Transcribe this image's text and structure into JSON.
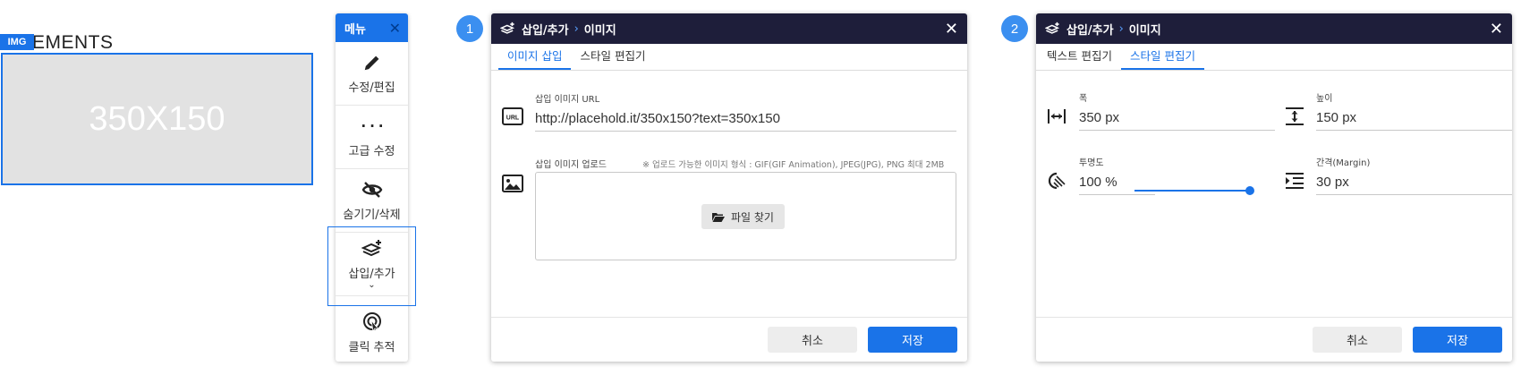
{
  "preview": {
    "heading": "EMENTS",
    "badge": "IMG",
    "placeholder_text": "350X150"
  },
  "menu": {
    "title": "메뉴",
    "close": "✕",
    "items": [
      {
        "label": "수정/편집",
        "icon": "pencil-icon"
      },
      {
        "label": "고급 수정",
        "icon": "code-braces-icon"
      },
      {
        "label": "숨기기/삭제",
        "icon": "eye-off-icon"
      },
      {
        "label": "삽입/추가",
        "icon": "layers-plus-icon",
        "chevron": "⌄"
      },
      {
        "label": "클릭 추적",
        "icon": "click-target-icon"
      }
    ]
  },
  "steps": [
    "1",
    "2"
  ],
  "dialog1": {
    "breadcrumb_parent": "삽입/추가",
    "breadcrumb_sep": "›",
    "breadcrumb_current": "이미지",
    "close": "✕",
    "tabs": [
      {
        "label": "이미지 삽입",
        "active": true
      },
      {
        "label": "스타일 편집기",
        "active": false
      }
    ],
    "url_label": "삽입 이미지 URL",
    "url_icon_text": "URL",
    "url_value": "http://placehold.it/350x150?text=350x150",
    "upload_label": "삽입 이미지 업로드",
    "upload_hint": "※ 업로드 가능한 이미지 형식 : GIF(GIF Animation), JPEG(JPG), PNG 최대 2MB",
    "find_file": "파일 찾기",
    "cancel": "취소",
    "save": "저장"
  },
  "dialog2": {
    "breadcrumb_parent": "삽입/추가",
    "breadcrumb_sep": "›",
    "breadcrumb_current": "이미지",
    "close": "✕",
    "tabs": [
      {
        "label": "텍스트 편집기",
        "active": false
      },
      {
        "label": "스타일 편집기",
        "active": true
      }
    ],
    "width_label": "폭",
    "width_value": "350 px",
    "height_label": "높이",
    "height_value": "150 px",
    "opacity_label": "투명도",
    "opacity_value": "100 %",
    "opacity_level": 1.0,
    "margin_label": "간격(Margin)",
    "margin_value": "30 px",
    "cancel": "취소",
    "save": "저장"
  },
  "colors": {
    "accent": "#1a73e8",
    "header_dark": "#1e1e3a",
    "step_badge": "#3b8ff0"
  }
}
